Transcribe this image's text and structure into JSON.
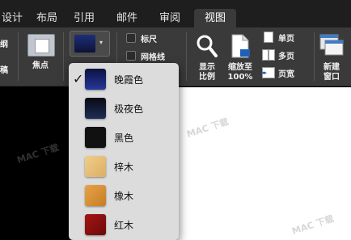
{
  "tabs": [
    {
      "label": "设计"
    },
    {
      "label": "布局"
    },
    {
      "label": "引用"
    },
    {
      "label": "邮件"
    },
    {
      "label": "审阅"
    },
    {
      "label": "视图"
    }
  ],
  "ribbon": {
    "left_fragment_top": "纲",
    "left_fragment_bottom": "稿",
    "focus_label": "焦点",
    "ruler_label": "标尺",
    "gridlines_label": "网格线",
    "show_label_line1": "显示",
    "show_label_line2": "比例",
    "zoom_label_line1": "缩放至",
    "zoom_label_line2": "100%",
    "single_page_label": "单页",
    "multi_page_label": "多页",
    "page_width_label": "页宽",
    "new_window_label_line1": "新建",
    "new_window_label_line2": "窗口"
  },
  "theme_menu": {
    "selected": "晚霞色",
    "items": [
      {
        "label": "晚霞色",
        "color": "#1a2a6c",
        "checked": "✓"
      },
      {
        "label": "极夜色",
        "color": "#0e1a33"
      },
      {
        "label": "黑色",
        "color": "#111111"
      },
      {
        "label": "梓木",
        "color": "#e8bf7a"
      },
      {
        "label": "橡木",
        "color": "#d9912e"
      },
      {
        "label": "红木",
        "color": "#8c0f0f"
      }
    ]
  },
  "watermark": "MAC 下载"
}
